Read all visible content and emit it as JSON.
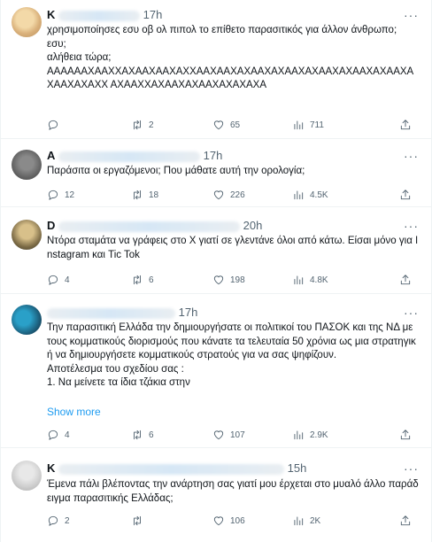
{
  "colors": {
    "accent": "#1d9bf0",
    "secondary_text": "#536471",
    "text": "#0f1419",
    "divider": "#eff3f4"
  },
  "tweets": [
    {
      "name_prefix": "K",
      "time": "17h",
      "text": "χρησιμοποίησες εσυ οβ ολ πιπολ το επίθετο παρασιτικός για άλλον άνθρωπο;\nεσυ;\nαλήθεια τώρα;\nΑΑΑΑΑΑΧΑΑΧΧΑΧΑΑΧΑΑΧΑΧΧΑΑΧΑΑΧΑΧΑΑΧΑΧΑΑΧΑΧΑΑΧΑΧΑΑΧΑΧΑΑΧΑΧΑΑΧΑΧΑΧΧ ΑΧΑΑΧΧΑΧΑΑΧΑΧΑΑΧΑΧΑΧΑΧΑ",
      "replies": "",
      "retweets": "2",
      "likes": "65",
      "views": "711"
    },
    {
      "name_prefix": "A",
      "time": "17h",
      "text": "Παράσιτα οι εργαζόμενοι; Που μάθατε αυτή την ορολογία;",
      "replies": "12",
      "retweets": "18",
      "likes": "226",
      "views": "4.5K"
    },
    {
      "name_prefix": "D",
      "time": "20h",
      "text": "Ντόρα σταμάτα να γράφεις στο Χ γιατί σε γλεντάνε όλοι από κάτω. Είσαι μόνο για Instagram και Tic Tok",
      "replies": "4",
      "retweets": "6",
      "likes": "198",
      "views": "4.8K"
    },
    {
      "name_prefix": "",
      "time": "17h",
      "text": "Την παρασιτική Ελλάδα την δημιουργήσατε οι πολιτικοί του ΠΑΣΟΚ και της ΝΔ με τους κομματικούς διορισμούς που κάνατε τα τελευταία 50 χρόνια ως μια στρατηγική να δημιουργήσετε κομματικούς στρατούς για να σας ψηφίζουν.\nΑποτέλεσμα του σχεδίου σας :\n1. Να μείνετε τα ίδια τζάκια στην",
      "show_more": "Show more",
      "replies": "4",
      "retweets": "6",
      "likes": "107",
      "views": "2.9K"
    },
    {
      "name_prefix": "K",
      "time": "15h",
      "text": "Έμενα πάλι βλέποντας την ανάρτηση σας γιατί μου έρχεται στο μυαλό άλλο παράδειγμα παρασιτικής Ελλάδας;",
      "replies": "2",
      "retweets": "",
      "likes": "106",
      "views": "2K"
    }
  ],
  "icons": [
    "reply-icon",
    "retweet-icon",
    "like-icon",
    "views-icon",
    "share-icon",
    "more-icon"
  ]
}
